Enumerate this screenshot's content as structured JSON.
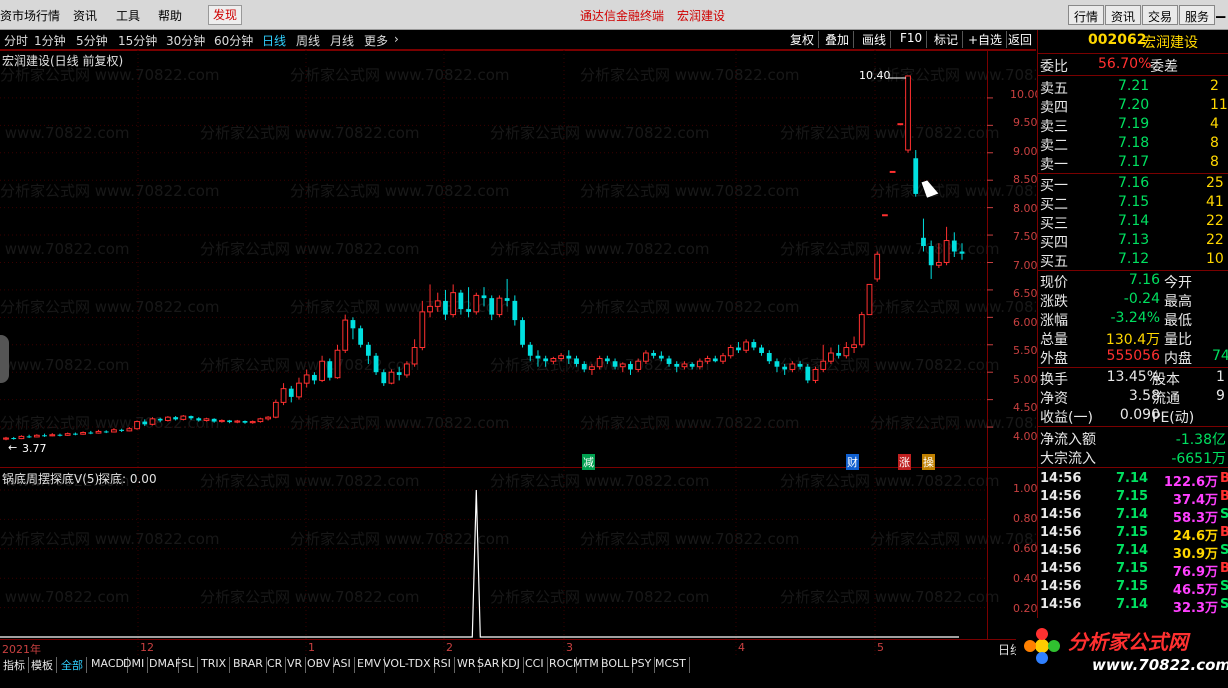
{
  "menu": {
    "items": [
      "资市场行情",
      "资讯",
      "工具",
      "帮助"
    ],
    "discover": "发现",
    "app_title": "通达信金融终端",
    "stock_title": "宏润建设",
    "right_buttons": [
      "行情",
      "资讯",
      "交易",
      "服务"
    ]
  },
  "toolbar": {
    "periods": [
      "分时",
      "1分钟",
      "5分钟",
      "15分钟",
      "30分钟",
      "60分钟",
      "日线",
      "周线",
      "月线",
      "更多"
    ],
    "active_period": "日线",
    "buttons": [
      "复权",
      "叠加",
      "画线",
      "F10",
      "标记",
      "+自选",
      "返回"
    ]
  },
  "chart": {
    "title": "宏润建设(日线 前复权)",
    "watermark": "分析家公式网 www.70822.com",
    "y_ticks": [
      "10.00",
      "9.50",
      "9.00",
      "8.50",
      "8.00",
      "7.50",
      "7.00",
      "6.50",
      "6.00",
      "5.50",
      "5.00",
      "4.50",
      "4.00"
    ],
    "high_label": "10.40",
    "low_label": "3.77",
    "event_marks": [
      {
        "text": "减",
        "color": "#00c060"
      },
      {
        "text": "财",
        "color": "#3090ff"
      },
      {
        "text": "涨",
        "color": "#ff4040"
      },
      {
        "text": "操",
        "color": "#ffd700"
      }
    ],
    "indicator_title": "锅底周摆探底V(5)",
    "indicator_value": "探底: 0.00",
    "indicator_ticks": [
      "1.00",
      "0.80",
      "0.60",
      "0.40",
      "0.20"
    ],
    "date_ticks": [
      "2021年",
      "12",
      "1",
      "2",
      "3",
      "4",
      "5"
    ],
    "corner_label": "日线"
  },
  "chart_data": {
    "type": "candlestick",
    "title": "宏润建设(日线 前复权)",
    "ylim": [
      3.6,
      10.6
    ],
    "candles": [
      [
        3.78,
        3.8,
        3.82,
        3.76
      ],
      [
        3.8,
        3.79,
        3.82,
        3.77
      ],
      [
        3.79,
        3.83,
        3.85,
        3.78
      ],
      [
        3.83,
        3.82,
        3.86,
        3.8
      ],
      [
        3.82,
        3.85,
        3.87,
        3.81
      ],
      [
        3.85,
        3.84,
        3.88,
        3.82
      ],
      [
        3.84,
        3.86,
        3.89,
        3.83
      ],
      [
        3.86,
        3.85,
        3.88,
        3.83
      ],
      [
        3.85,
        3.88,
        3.9,
        3.84
      ],
      [
        3.88,
        3.87,
        3.9,
        3.85
      ],
      [
        3.87,
        3.9,
        3.92,
        3.86
      ],
      [
        3.9,
        3.89,
        3.93,
        3.87
      ],
      [
        3.89,
        3.92,
        3.95,
        3.88
      ],
      [
        3.92,
        3.91,
        3.94,
        3.89
      ],
      [
        3.91,
        3.95,
        3.98,
        3.9
      ],
      [
        3.95,
        3.93,
        3.97,
        3.91
      ],
      [
        3.93,
        3.97,
        4.0,
        3.92
      ],
      [
        3.97,
        4.1,
        4.12,
        3.95
      ],
      [
        4.1,
        4.05,
        4.14,
        4.02
      ],
      [
        4.05,
        4.15,
        4.18,
        4.03
      ],
      [
        4.15,
        4.12,
        4.17,
        4.09
      ],
      [
        4.12,
        4.18,
        4.2,
        4.1
      ],
      [
        4.18,
        4.14,
        4.2,
        4.12
      ],
      [
        4.14,
        4.2,
        4.22,
        4.12
      ],
      [
        4.2,
        4.16,
        4.21,
        4.13
      ],
      [
        4.16,
        4.12,
        4.18,
        4.1
      ],
      [
        4.12,
        4.15,
        4.17,
        4.1
      ],
      [
        4.15,
        4.1,
        4.16,
        4.08
      ],
      [
        4.1,
        4.12,
        4.14,
        4.08
      ],
      [
        4.12,
        4.09,
        4.13,
        4.07
      ],
      [
        4.09,
        4.11,
        4.13,
        4.07
      ],
      [
        4.11,
        4.08,
        4.12,
        4.06
      ],
      [
        4.08,
        4.1,
        4.12,
        4.06
      ],
      [
        4.1,
        4.15,
        4.17,
        4.08
      ],
      [
        4.15,
        4.18,
        4.2,
        4.12
      ],
      [
        4.18,
        4.45,
        4.5,
        4.16
      ],
      [
        4.45,
        4.7,
        4.8,
        4.4
      ],
      [
        4.7,
        4.55,
        4.75,
        4.45
      ],
      [
        4.55,
        4.8,
        4.9,
        4.5
      ],
      [
        4.8,
        4.95,
        5.05,
        4.72
      ],
      [
        4.95,
        4.85,
        5.0,
        4.78
      ],
      [
        4.85,
        5.2,
        5.3,
        4.82
      ],
      [
        5.2,
        4.9,
        5.25,
        4.85
      ],
      [
        4.9,
        5.4,
        5.5,
        4.88
      ],
      [
        5.4,
        5.95,
        6.05,
        5.35
      ],
      [
        5.95,
        5.8,
        6.0,
        5.6
      ],
      [
        5.8,
        5.5,
        5.85,
        5.45
      ],
      [
        5.5,
        5.3,
        5.55,
        5.15
      ],
      [
        5.3,
        5.0,
        5.35,
        4.95
      ],
      [
        5.0,
        4.8,
        5.05,
        4.75
      ],
      [
        4.8,
        5.0,
        5.05,
        4.78
      ],
      [
        5.0,
        4.95,
        5.1,
        4.85
      ],
      [
        4.95,
        5.15,
        5.2,
        4.9
      ],
      [
        5.15,
        5.45,
        5.6,
        5.1
      ],
      [
        5.45,
        6.1,
        6.3,
        5.4
      ],
      [
        6.1,
        6.2,
        6.6,
        6.0
      ],
      [
        6.2,
        6.3,
        6.45,
        6.1
      ],
      [
        6.3,
        6.05,
        6.5,
        5.95
      ],
      [
        6.05,
        6.45,
        6.6,
        6.0
      ],
      [
        6.45,
        6.15,
        6.5,
        6.05
      ],
      [
        6.15,
        6.1,
        6.55,
        6.0
      ],
      [
        6.1,
        6.4,
        6.45,
        6.05
      ],
      [
        6.4,
        6.35,
        6.55,
        6.2
      ],
      [
        6.35,
        6.05,
        6.4,
        5.95
      ],
      [
        6.05,
        6.35,
        6.4,
        6.0
      ],
      [
        6.35,
        6.3,
        6.7,
        6.2
      ],
      [
        6.3,
        5.95,
        6.4,
        5.85
      ],
      [
        5.95,
        5.5,
        6.0,
        5.45
      ],
      [
        5.5,
        5.3,
        5.55,
        5.2
      ],
      [
        5.3,
        5.25,
        5.4,
        5.1
      ],
      [
        5.25,
        5.2,
        5.3,
        5.1
      ],
      [
        5.2,
        5.25,
        5.28,
        5.15
      ],
      [
        5.25,
        5.3,
        5.35,
        5.2
      ],
      [
        5.3,
        5.25,
        5.4,
        5.15
      ],
      [
        5.25,
        5.15,
        5.3,
        5.1
      ],
      [
        5.15,
        5.05,
        5.2,
        5.0
      ],
      [
        5.05,
        5.1,
        5.15,
        4.95
      ],
      [
        5.1,
        5.25,
        5.3,
        5.05
      ],
      [
        5.25,
        5.2,
        5.3,
        5.15
      ],
      [
        5.2,
        5.1,
        5.25,
        5.05
      ],
      [
        5.1,
        5.15,
        5.18,
        5.0
      ],
      [
        5.15,
        5.05,
        5.2,
        4.95
      ],
      [
        5.05,
        5.2,
        5.25,
        5.0
      ],
      [
        5.2,
        5.35,
        5.4,
        5.15
      ],
      [
        5.35,
        5.3,
        5.4,
        5.25
      ],
      [
        5.3,
        5.25,
        5.38,
        5.2
      ],
      [
        5.25,
        5.15,
        5.3,
        5.1
      ],
      [
        5.15,
        5.1,
        5.2,
        5.0
      ],
      [
        5.1,
        5.15,
        5.2,
        5.05
      ],
      [
        5.15,
        5.1,
        5.18,
        5.05
      ],
      [
        5.1,
        5.2,
        5.25,
        5.05
      ],
      [
        5.2,
        5.25,
        5.3,
        5.15
      ],
      [
        5.25,
        5.2,
        5.3,
        5.18
      ],
      [
        5.2,
        5.3,
        5.35,
        5.15
      ],
      [
        5.3,
        5.45,
        5.5,
        5.25
      ],
      [
        5.45,
        5.4,
        5.55,
        5.35
      ],
      [
        5.4,
        5.55,
        5.6,
        5.35
      ],
      [
        5.55,
        5.45,
        5.6,
        5.4
      ],
      [
        5.45,
        5.35,
        5.5,
        5.3
      ],
      [
        5.35,
        5.2,
        5.4,
        5.15
      ],
      [
        5.2,
        5.1,
        5.25,
        5.0
      ],
      [
        5.1,
        5.05,
        5.15,
        4.95
      ],
      [
        5.05,
        5.15,
        5.2,
        5.0
      ],
      [
        5.15,
        5.1,
        5.2,
        5.05
      ],
      [
        5.1,
        4.85,
        5.15,
        4.8
      ],
      [
        4.85,
        5.05,
        5.1,
        4.8
      ],
      [
        5.05,
        5.2,
        5.5,
        5.0
      ],
      [
        5.2,
        5.35,
        5.45,
        5.15
      ],
      [
        5.35,
        5.3,
        5.5,
        5.25
      ],
      [
        5.3,
        5.45,
        5.55,
        5.25
      ],
      [
        5.45,
        5.5,
        5.65,
        5.35
      ],
      [
        5.5,
        6.05,
        6.1,
        5.45
      ],
      [
        6.05,
        6.6,
        6.6,
        6.6
      ],
      [
        6.7,
        7.15,
        7.2,
        6.65
      ],
      [
        7.87,
        7.87,
        7.87,
        7.87
      ],
      [
        8.66,
        8.66,
        8.66,
        8.66
      ],
      [
        9.53,
        9.53,
        9.53,
        9.53
      ],
      [
        9.05,
        10.4,
        10.4,
        9.0
      ],
      [
        8.9,
        8.25,
        9.05,
        8.2
      ],
      [
        7.45,
        7.3,
        7.8,
        7.2
      ],
      [
        7.3,
        6.95,
        7.4,
        6.7
      ],
      [
        6.95,
        7.0,
        7.35,
        6.9
      ],
      [
        7.0,
        7.4,
        7.65,
        6.95
      ],
      [
        7.4,
        7.2,
        7.55,
        7.1
      ],
      [
        7.2,
        7.16,
        7.35,
        7.05
      ]
    ],
    "indicator": {
      "name": "锅底周摆探底V(5)",
      "ylim": [
        0,
        1
      ],
      "spike_at_index": 61,
      "spike_value": 1.0
    }
  },
  "tabs": [
    "指标",
    "模板",
    "全部",
    "MACD",
    "DMI",
    "DMA",
    "FSL",
    "TRIX",
    "BRAR",
    "CR",
    "VR",
    "OBV",
    "ASI",
    "EMV",
    "VOL-TDX",
    "RSI",
    "WR",
    "SAR",
    "KDJ",
    "CCI",
    "ROC",
    "MTM",
    "BOLL",
    "PSY",
    "MCST"
  ],
  "active_tab": "全部",
  "panel": {
    "code": "002062",
    "name": "宏润建设",
    "weibi_label": "委比",
    "weibi_value": "56.70%",
    "weicha_label": "委差",
    "sell": [
      {
        "label": "卖五",
        "price": "7.21",
        "vol": "2"
      },
      {
        "label": "卖四",
        "price": "7.20",
        "vol": "11"
      },
      {
        "label": "卖三",
        "price": "7.19",
        "vol": "4"
      },
      {
        "label": "卖二",
        "price": "7.18",
        "vol": "8"
      },
      {
        "label": "卖一",
        "price": "7.17",
        "vol": "8"
      }
    ],
    "buy": [
      {
        "label": "买一",
        "price": "7.16",
        "vol": "25"
      },
      {
        "label": "买二",
        "price": "7.15",
        "vol": "41"
      },
      {
        "label": "买三",
        "price": "7.14",
        "vol": "22"
      },
      {
        "label": "买四",
        "price": "7.13",
        "vol": "22"
      },
      {
        "label": "买五",
        "price": "7.12",
        "vol": "10"
      }
    ],
    "quote": [
      {
        "l1": "现价",
        "v1": "7.16",
        "c1": "green",
        "l2": "今开"
      },
      {
        "l1": "涨跌",
        "v1": "-0.24",
        "c1": "green",
        "l2": "最高"
      },
      {
        "l1": "涨幅",
        "v1": "-3.24%",
        "c1": "green",
        "l2": "最低"
      },
      {
        "l1": "总量",
        "v1": "130.4万",
        "c1": "yellow",
        "l2": "量比"
      },
      {
        "l1": "外盘",
        "v1": "555056",
        "c1": "red",
        "l2": "内盘",
        "v2": "74",
        "c2": "green"
      }
    ],
    "fund": [
      {
        "l1": "换手",
        "v1": "13.45%",
        "c1": "white",
        "l2": "股本",
        "v2": "1",
        "c2": "white"
      },
      {
        "l1": "净资",
        "v1": "3.58",
        "c1": "white",
        "l2": "流通",
        "v2": "9",
        "c2": "white"
      },
      {
        "l1": "收益(一)",
        "v1": "0.090",
        "c1": "white",
        "l2": "PE(动)",
        "v2": "",
        "c2": "white"
      }
    ],
    "flow": [
      {
        "label": "净流入额",
        "value": "-1.38亿"
      },
      {
        "label": "大宗流入",
        "value": "-6651万"
      }
    ],
    "ticks": [
      {
        "time": "14:56",
        "price": "7.14",
        "vol": "122.6万",
        "vcolor": "magenta",
        "bs": "B",
        "bscolor": "red"
      },
      {
        "time": "14:56",
        "price": "7.15",
        "vol": "37.4万",
        "vcolor": "magenta",
        "bs": "B",
        "bscolor": "red"
      },
      {
        "time": "14:56",
        "price": "7.14",
        "vol": "58.3万",
        "vcolor": "magenta",
        "bs": "S",
        "bscolor": "green"
      },
      {
        "time": "14:56",
        "price": "7.15",
        "vol": "24.6万",
        "vcolor": "yellow",
        "bs": "B",
        "bscolor": "red"
      },
      {
        "time": "14:56",
        "price": "7.14",
        "vol": "30.9万",
        "vcolor": "yellow",
        "bs": "S",
        "bscolor": "green"
      },
      {
        "time": "14:56",
        "price": "7.15",
        "vol": "76.9万",
        "vcolor": "magenta",
        "bs": "B",
        "bscolor": "red"
      },
      {
        "time": "14:56",
        "price": "7.15",
        "vol": "46.5万",
        "vcolor": "magenta",
        "bs": "S",
        "bscolor": "green"
      },
      {
        "time": "14:56",
        "price": "7.14",
        "vol": "32.3万",
        "vcolor": "magenta",
        "bs": "S",
        "bscolor": "green"
      }
    ]
  },
  "logo": {
    "title": "分析家公式网",
    "url": "www.70822.com"
  },
  "colors": {
    "up": "#ff3030",
    "down": "#00e0e0",
    "grid": "#7a0000",
    "accent": "#30d0ff"
  }
}
